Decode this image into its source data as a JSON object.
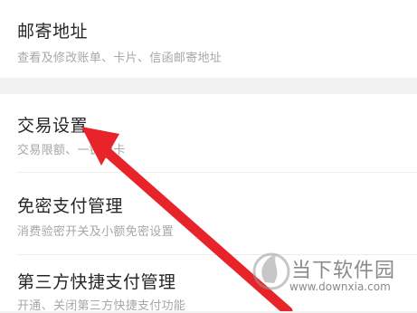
{
  "items": [
    {
      "title": "邮寄地址",
      "subtitle": "查看及修改账单、卡片、信函邮寄地址"
    },
    {
      "title": "交易设置",
      "subtitle": "交易限额、一键锁卡"
    },
    {
      "title": "免密支付管理",
      "subtitle": "消费验密开关及小额免密设置"
    },
    {
      "title": "第三方快捷支付管理",
      "subtitle": "开通、关闭第三方快捷支付功能"
    }
  ],
  "watermark": {
    "name": "当下软件园",
    "url": "www.downxia.com"
  },
  "colors": {
    "arrow": "#e8242b",
    "background": "#f2f2f4",
    "card": "#ffffff"
  }
}
